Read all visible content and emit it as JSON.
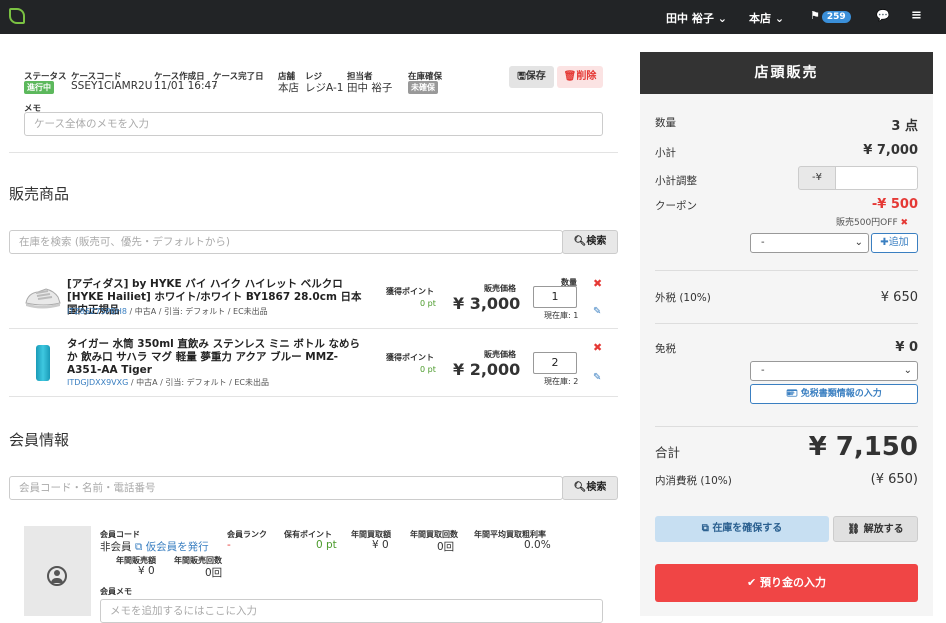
{
  "topbar": {
    "user": "田中 裕子",
    "store": "本店",
    "flag_count": "259"
  },
  "case": {
    "status_label": "ステータス",
    "status": "進行中",
    "code_label": "ケースコード",
    "code": "SSEY1CIAMR2U",
    "created_label": "ケース作成日",
    "created": "11/01 16:47",
    "done_label": "ケース完了日",
    "done": "-",
    "store_label": "店舗",
    "store": "本店",
    "register_label": "レジ",
    "register": "レジA-1",
    "staff_label": "担当者",
    "staff": "田中 裕子",
    "stock_label": "在庫確保",
    "stock": "未確保",
    "save": "保存",
    "delete": "削除",
    "memo_label": "メモ",
    "memo_placeholder": "ケース全体のメモを入力"
  },
  "sales": {
    "title": "販売商品",
    "search_placeholder": "在庫を検索 (販売可、優先・デフォルトから)",
    "search_button": "検索",
    "points_label": "獲得ポイント",
    "price_label": "販売価格",
    "qty_label": "数量",
    "items": [
      {
        "title": "[アディダス] by HYKE バイ ハイク ハイレット ベルクロ [HYKE Hailiet] ホワイト/ホワイト BY1867 28.0cm 日本国内正規品",
        "code": "ITZ86Z75PBH8",
        "meta": " / 中古A / 引当: デフォルト / EC未出品",
        "points": "0 pt",
        "price": "¥ 3,000",
        "qty": "1",
        "stock": "現在庫: 1"
      },
      {
        "title": "タイガー 水筒 350ml 直飲み ステンレス ミニ ボトル なめらか 飲み口 サハラ マグ 軽量 夢重力 アクア ブルー MMZ-A351-AA Tiger",
        "code": "ITDGJDXX9VXG",
        "meta": " / 中古A / 引当: デフォルト / EC未出品",
        "points": "0 pt",
        "price": "¥ 2,000",
        "qty": "2",
        "stock": "現在庫: 2"
      }
    ]
  },
  "member": {
    "title": "会員情報",
    "search_placeholder": "会員コード・名前・電話番号",
    "search_button": "検索",
    "code_label": "会員コード",
    "code": "非会員",
    "issue_link": "仮会員を発行",
    "rank_label": "会員ランク",
    "rank": "-",
    "points_label": "保有ポイント",
    "points": "0 pt",
    "buy_amount_label": "年間買取額",
    "buy_amount": "¥ 0",
    "buy_count_label": "年間買取回数",
    "buy_count": "0回",
    "margin_label": "年間平均買取粗利率",
    "margin": "0.0%",
    "sales_amount_label": "年間販売額",
    "sales_amount": "¥ 0",
    "sales_count_label": "年間販売回数",
    "sales_count": "0回",
    "memo_label": "会員メモ",
    "memo_placeholder": "メモを追加するにはここに入力"
  },
  "register": {
    "title": "店頭販売",
    "qty_label": "数量",
    "qty": "3 点",
    "subtotal_label": "小計",
    "subtotal": "¥ 7,000",
    "adjust_label": "小計調整",
    "adjust_prefix": "-¥",
    "coupon_label": "クーポン",
    "coupon": "-¥ 500",
    "coupon_note": "販売500円OFF",
    "coupon_select": "-",
    "add_button": "追加",
    "tax_label": "外税 (10%)",
    "tax": "¥ 650",
    "exempt_label": "免税",
    "exempt": "¥ 0",
    "exempt_select": "-",
    "exempt_doc_button": "免税書類情報の入力",
    "total_label": "合計",
    "total": "¥ 7,150",
    "inner_tax_label": "内消費税 (10%)",
    "inner_tax": "(¥ 650)",
    "reserve_button": "在庫を確保する",
    "release_button": "解放する",
    "deposit_button": "預り金の入力"
  }
}
